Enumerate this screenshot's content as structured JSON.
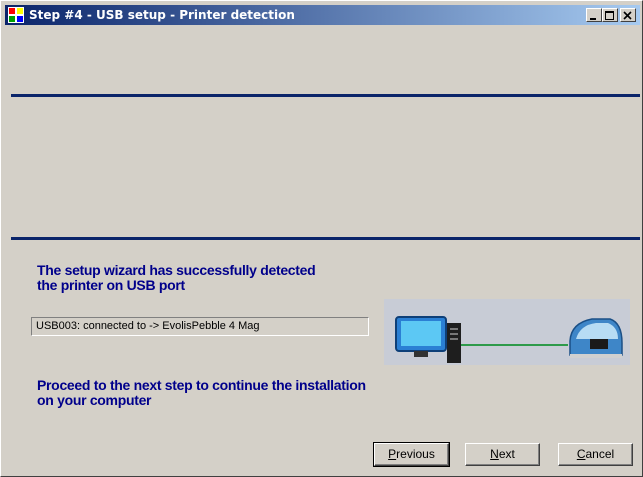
{
  "window": {
    "title": "Step #4 - USB setup - Printer detection",
    "title_colors": {
      "active_start": "#0a246a",
      "active_end": "#a6caf0"
    }
  },
  "colors": {
    "accent": "#0a246a",
    "message_text": "#00008b",
    "face": "#d4d0c8"
  },
  "status": {
    "detected_line1": "The setup wizard has successfully detected",
    "detected_line2": "the printer on USB port"
  },
  "usb_field": {
    "value": "USB003:  connected to -> EvolisPebble 4 Mag"
  },
  "instructions": {
    "line1": "Proceed to the next step to continue the installation",
    "line2": "on your computer"
  },
  "buttons": {
    "previous": {
      "prefix": "",
      "accel": "P",
      "rest": "revious"
    },
    "next": {
      "prefix": "",
      "accel": "N",
      "rest": "ext"
    },
    "cancel": {
      "prefix": "",
      "accel": "C",
      "rest": "ancel"
    }
  },
  "icons": {
    "app": "app-icon",
    "computer": "computer-icon",
    "printer": "card-printer-icon",
    "connection": "connection-line"
  }
}
